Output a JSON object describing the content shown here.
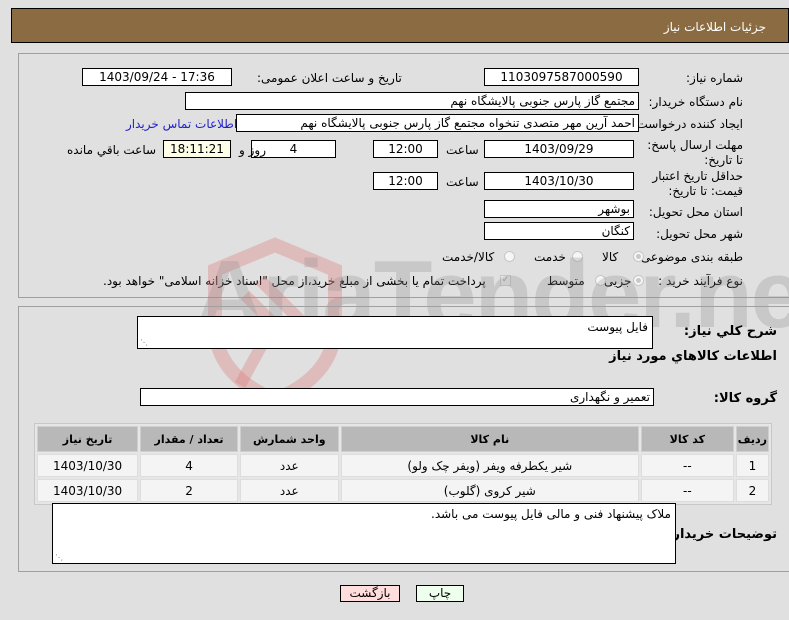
{
  "header": {
    "title": "جزئیات اطلاعات نیاز"
  },
  "form": {
    "need_number": {
      "label": "شماره نیاز:",
      "value": "1103097587000590"
    },
    "announce_datetime": {
      "label": "تاریخ و ساعت اعلان عمومی:",
      "value": "1403/09/24 - 17:36"
    },
    "buyer_org": {
      "label": "نام دستگاه خریدار:",
      "value": "مجتمع گاز پارس جنوبی  پالایشگاه نهم"
    },
    "requester": {
      "label": "ایجاد کننده درخواست:",
      "value": "احمد آرین مهر متصدی تنخواه مجتمع گاز پارس جنوبی  پالایشگاه نهم"
    },
    "buyer_contact_link": "اطلاعات تماس خریدار",
    "response_deadline": {
      "label": "مهلت ارسال پاسخ: تا تاریخ:",
      "date": "1403/09/29",
      "time_label": "ساعت",
      "time": "12:00",
      "days": "4",
      "days_label": "روز و",
      "remaining": "18:11:21",
      "remaining_label": "ساعت باقي مانده"
    },
    "price_validity": {
      "label": "حداقل تاریخ اعتبار قیمت: تا تاریخ:",
      "date": "1403/10/30",
      "time_label": "ساعت",
      "time": "12:00"
    },
    "province": {
      "label": "استان محل تحویل:",
      "value": "بوشهر"
    },
    "city": {
      "label": "شهر محل تحویل:",
      "value": "کنگان"
    },
    "category": {
      "label": "طبقه بندی موضوعی:",
      "options": [
        "کالا",
        "خدمت",
        "کالا/خدمت"
      ],
      "selected": "کالا"
    },
    "purchase_type": {
      "label": "نوع فرآیند خرید :",
      "options": [
        "جزیی",
        "متوسط"
      ],
      "selected": "جزیی",
      "payment_note": "پرداخت تمام یا بخشی از مبلغ خرید،از محل \"اسناد خزانه اسلامی\" خواهد بود."
    }
  },
  "details": {
    "summary_label": "شرح کلي نياز:",
    "summary_value": "فایل پیوست",
    "items_heading": "اطلاعات کالاهاي مورد نياز",
    "group_label": "گروه کالا:",
    "group_value": "تعمیر و نگهداری",
    "table": {
      "headers": [
        "ردیف",
        "کد کالا",
        "نام کالا",
        "واحد شمارش",
        "تعداد / مقدار",
        "تاریخ نیاز"
      ],
      "rows": [
        [
          "1",
          "--",
          "شیر یکطرفه ویفر (ویفر چک ولو)",
          "عدد",
          "4",
          "1403/10/30"
        ],
        [
          "2",
          "--",
          "شیر کروی (گلوب)",
          "عدد",
          "2",
          "1403/10/30"
        ]
      ]
    },
    "buyer_notes_label": "توضیحات خریدار:",
    "buyer_notes_value": "ملاک پیشنهاد فنی و مالی فایل پیوست می باشد."
  },
  "buttons": {
    "print": "چاپ",
    "back": "بازگشت"
  },
  "watermark": "AriaTender.neT",
  "colors": {
    "header_bg": "#8b6c42",
    "print_bg": "#eeffee",
    "back_bg": "#ffdddd",
    "link": "#2222cc"
  }
}
